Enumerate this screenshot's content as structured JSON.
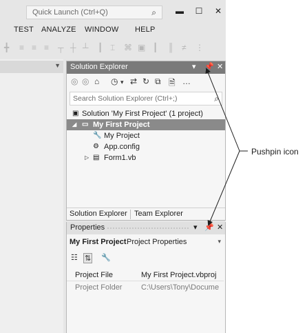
{
  "titlebar": {
    "quick_launch_placeholder": "Quick Launch (Ctrl+Q)",
    "minimize_glyph": "▬",
    "maximize_glyph": "☐",
    "close_glyph": "✕"
  },
  "menubar": {
    "items": [
      "TEST",
      "ANALYZE",
      "WINDOW",
      "HELP"
    ]
  },
  "solution_explorer": {
    "title": "Solution Explorer",
    "search_placeholder": "Search Solution Explorer (Ctrl+;)",
    "tree": [
      {
        "label": "Solution 'My First Project' (1 project)",
        "icon": "solution-icon"
      },
      {
        "label": "My First Project",
        "icon": "project-icon",
        "selected": true
      },
      {
        "label": "My Project",
        "icon": "wrench-icon"
      },
      {
        "label": "App.config",
        "icon": "config-file-icon"
      },
      {
        "label": "Form1.vb",
        "icon": "form-icon"
      }
    ],
    "tabs": [
      "Solution Explorer",
      "Team Explorer"
    ]
  },
  "properties": {
    "title": "Properties",
    "object_name": "My First Project",
    "object_type": "Project Properties",
    "rows": [
      {
        "name": "Project File",
        "value": "My First Project.vbproj"
      },
      {
        "name": "Project Folder",
        "value": "C:\\Users\\Tony\\Docume"
      }
    ]
  },
  "annotation": {
    "label": "Pushpin icon"
  },
  "colors": {
    "panel_header_active": "#7a7a7a",
    "selected_row": "#8a8a8a",
    "chrome_background": "#e6e6e6"
  }
}
